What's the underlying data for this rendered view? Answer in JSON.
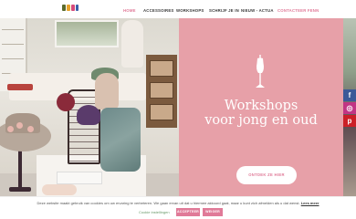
{
  "header": {
    "logo_icon": "fenn-logo",
    "nav": [
      {
        "label": "HOME"
      },
      {
        "label": "ACCESSOIRES"
      },
      {
        "label": "WORKSHOPS"
      },
      {
        "label": "SCHRIJF JE IN"
      },
      {
        "label": "NIEUW - ACTUA"
      },
      {
        "label": "CONTACTEER FENN"
      }
    ],
    "active_color": "#e07a98"
  },
  "hero": {
    "icon": "dress-form-icon",
    "title_line1": "Workshops",
    "title_line2": "voor jong en oud",
    "button_label": "ONTDEK ZE HIER",
    "background_color": "#e7a0a8"
  },
  "social": [
    {
      "icon": "facebook-icon",
      "glyph": "f",
      "color": "#3b5998"
    },
    {
      "icon": "instagram-icon",
      "glyph": "◎",
      "color": "#c13584"
    },
    {
      "icon": "pinterest-icon",
      "glyph": "p",
      "color": "#cb2027"
    }
  ],
  "cookie": {
    "text": "Deze website maakt gebruik van cookies om uw ervaring te verbeteren. We gaan ervan uit dat u hiermee akkoord gaat, maar u kunt zich afmelden als u dat wenst.",
    "link": "Lees meer",
    "settings": "Cookie instellingen",
    "accept": "ACCEPTEER",
    "reject": "WEIGER"
  }
}
